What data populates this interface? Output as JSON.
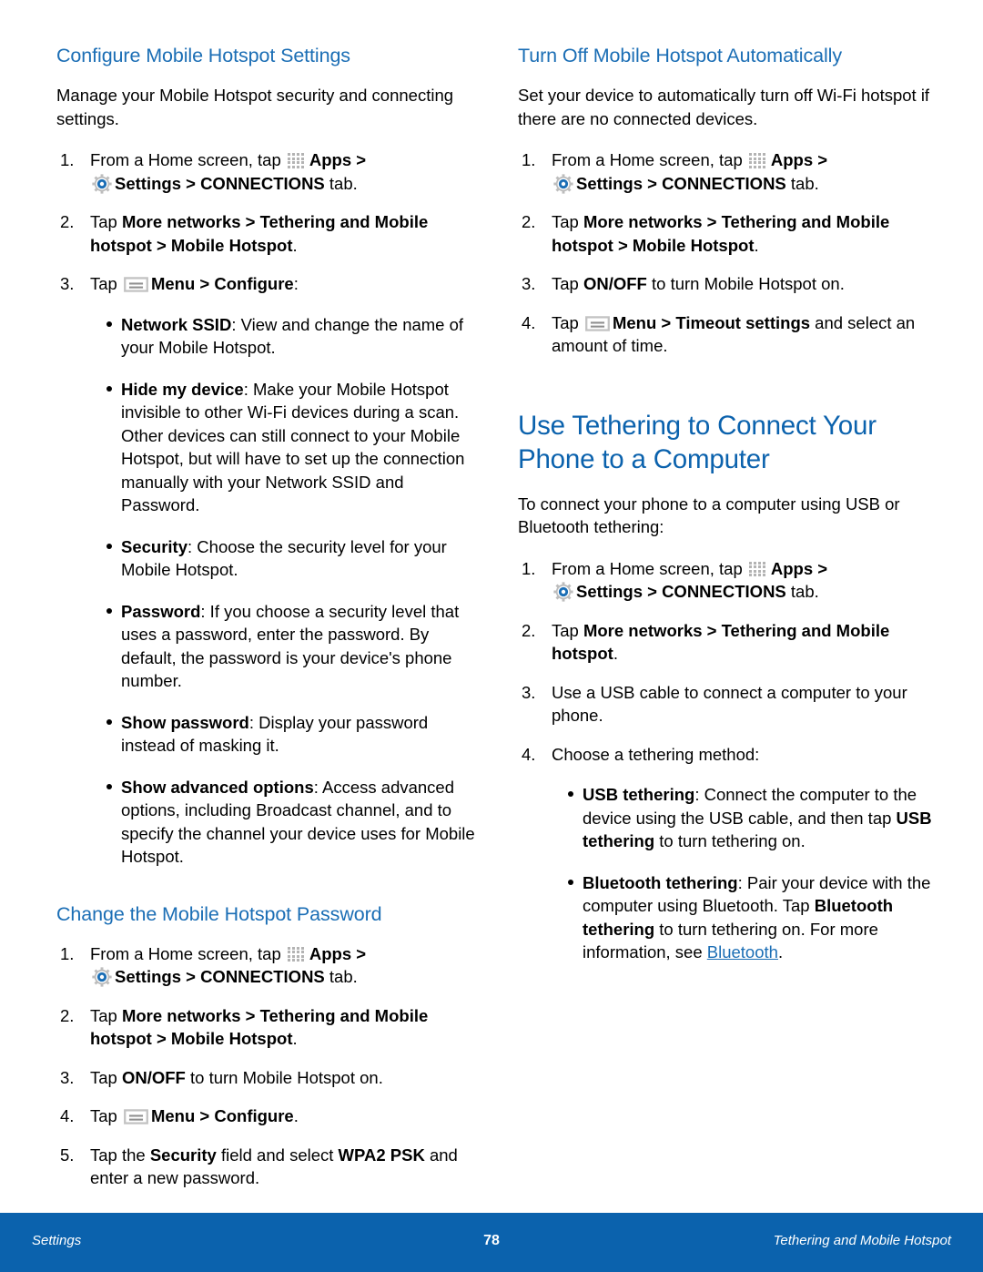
{
  "page": {
    "number": "78",
    "footer_left": "Settings",
    "footer_right": "Tethering and Mobile Hotspot",
    "footer_bg": "#0b62ad",
    "heading_color": "#1b6eb5",
    "title_color": "#0b62ad",
    "link_color": "#1b6eb5"
  },
  "icons": {
    "apps": "apps-grid-icon",
    "settings": "gear-icon",
    "menu": "menu-icon"
  },
  "left_column": {
    "section1": {
      "heading": "Configure Mobile Hotspot Settings",
      "intro": "Manage your Mobile Hotspot security and connecting settings.",
      "steps": [
        {
          "num": "1.",
          "parts": [
            {
              "t": "From a Home screen, tap ",
              "b": false
            },
            {
              "icon": "apps"
            },
            {
              "t": "Apps > ",
              "b": true
            },
            {
              "br": true
            },
            {
              "icon": "gear"
            },
            {
              "t": "Settings > CONNECTIONS",
              "b": true
            },
            {
              "t": " tab.",
              "b": false
            }
          ]
        },
        {
          "num": "2.",
          "parts": [
            {
              "t": "Tap ",
              "b": false
            },
            {
              "t": "More networks > Tethering and Mobile hotspot > Mobile Hotspot",
              "b": true
            },
            {
              "t": ".",
              "b": false
            }
          ]
        },
        {
          "num": "3.",
          "parts": [
            {
              "t": "Tap ",
              "b": false
            },
            {
              "icon": "menu"
            },
            {
              "t": "Menu > Configure",
              "b": true
            },
            {
              "t": ":",
              "b": false
            }
          ],
          "bullets": [
            {
              "label": "Network SSID",
              "text": ": View and change the name of your Mobile Hotspot."
            },
            {
              "label": "Hide my device",
              "text": ": Make your Mobile Hotspot invisible to other Wi-Fi devices during a scan. Other devices can still connect to your Mobile Hotspot, but will have to set up the connection manually with your Network SSID and Password."
            },
            {
              "label": "Security",
              "text": ": Choose the security level for your Mobile Hotspot."
            },
            {
              "label": "Password",
              "text": ": If you choose a security level that uses a password, enter the password. By default, the password is your device's phone number."
            },
            {
              "label": "Show password",
              "text": ": Display your password instead of masking it."
            },
            {
              "label": "Show advanced options",
              "text": ": Access advanced options, including Broadcast channel, and to specify the channel your device uses for Mobile Hotspot."
            }
          ]
        }
      ]
    },
    "section2": {
      "heading": "Change the Mobile Hotspot Password",
      "steps": [
        {
          "num": "1.",
          "parts": [
            {
              "t": "From a Home screen, tap ",
              "b": false
            },
            {
              "icon": "apps"
            },
            {
              "t": "Apps > ",
              "b": true
            },
            {
              "br": true
            },
            {
              "icon": "gear"
            },
            {
              "t": "Settings > CONNECTIONS",
              "b": true
            },
            {
              "t": " tab.",
              "b": false
            }
          ]
        },
        {
          "num": "2.",
          "parts": [
            {
              "t": "Tap ",
              "b": false
            },
            {
              "t": "More networks > Tethering and Mobile hotspot > Mobile Hotspot",
              "b": true
            },
            {
              "t": ".",
              "b": false
            }
          ]
        },
        {
          "num": "3.",
          "parts": [
            {
              "t": "Tap ",
              "b": false
            },
            {
              "t": "ON/OFF",
              "b": true
            },
            {
              "t": " to turn Mobile Hotspot on.",
              "b": false
            }
          ]
        },
        {
          "num": "4.",
          "parts": [
            {
              "t": "Tap ",
              "b": false
            },
            {
              "icon": "menu"
            },
            {
              "t": "Menu > Configure",
              "b": true
            },
            {
              "t": ".",
              "b": false
            }
          ]
        },
        {
          "num": "5.",
          "parts": [
            {
              "t": "Tap the ",
              "b": false
            },
            {
              "t": "Security",
              "b": true
            },
            {
              "t": " field and select ",
              "b": false
            },
            {
              "t": "WPA2 PSK",
              "b": true
            },
            {
              "t": " and enter a new password.",
              "b": false
            }
          ]
        }
      ]
    }
  },
  "right_column": {
    "section1": {
      "heading": "Turn Off Mobile Hotspot Automatically",
      "intro": "Set your device to automatically turn off Wi-Fi hotspot if there are no connected devices.",
      "steps": [
        {
          "num": "1.",
          "parts": [
            {
              "t": "From a Home screen, tap ",
              "b": false
            },
            {
              "icon": "apps"
            },
            {
              "t": "Apps > ",
              "b": true
            },
            {
              "br": true
            },
            {
              "icon": "gear"
            },
            {
              "t": "Settings > CONNECTIONS",
              "b": true
            },
            {
              "t": " tab.",
              "b": false
            }
          ]
        },
        {
          "num": "2.",
          "parts": [
            {
              "t": "Tap ",
              "b": false
            },
            {
              "t": "More networks > Tethering and Mobile hotspot > Mobile Hotspot",
              "b": true
            },
            {
              "t": ".",
              "b": false
            }
          ]
        },
        {
          "num": "3.",
          "parts": [
            {
              "t": "Tap ",
              "b": false
            },
            {
              "t": "ON/OFF",
              "b": true
            },
            {
              "t": " to turn Mobile Hotspot on.",
              "b": false
            }
          ]
        },
        {
          "num": "4.",
          "parts": [
            {
              "t": "Tap ",
              "b": false
            },
            {
              "icon": "menu"
            },
            {
              "t": "Menu > Timeout settings",
              "b": true
            },
            {
              "t": " and select an amount of time.",
              "b": false
            }
          ]
        }
      ]
    },
    "section2": {
      "title": "Use Tethering to Connect Your Phone to a Computer",
      "intro": "To connect your phone to a computer using USB or Bluetooth tethering:",
      "steps": [
        {
          "num": "1.",
          "parts": [
            {
              "t": "From a Home screen, tap ",
              "b": false
            },
            {
              "icon": "apps"
            },
            {
              "t": "Apps > ",
              "b": true
            },
            {
              "br": true
            },
            {
              "icon": "gear"
            },
            {
              "t": "Settings > CONNECTIONS",
              "b": true
            },
            {
              "t": " tab.",
              "b": false
            }
          ]
        },
        {
          "num": "2.",
          "parts": [
            {
              "t": "Tap ",
              "b": false
            },
            {
              "t": "More networks > Tethering and Mobile hotspot",
              "b": true
            },
            {
              "t": ".",
              "b": false
            }
          ]
        },
        {
          "num": "3.",
          "parts": [
            {
              "t": "Use a USB cable to connect a computer to your phone.",
              "b": false
            }
          ]
        },
        {
          "num": "4.",
          "parts": [
            {
              "t": "Choose a tethering method:",
              "b": false
            }
          ],
          "bullets": [
            {
              "label": "USB tethering",
              "segments": [
                {
                  "t": ": Connect the computer to the device using the USB cable, and then tap ",
                  "b": false
                },
                {
                  "t": "USB tethering",
                  "b": true
                },
                {
                  "t": " to turn tethering on.",
                  "b": false
                }
              ]
            },
            {
              "label": "Bluetooth tethering",
              "segments": [
                {
                  "t": ": Pair your device with the computer using Bluetooth. Tap ",
                  "b": false
                },
                {
                  "t": "Bluetooth tethering",
                  "b": true
                },
                {
                  "t": " to turn tethering on. For more information, see ",
                  "b": false
                },
                {
                  "t": "Bluetooth",
                  "link": true
                },
                {
                  "t": ".",
                  "b": false
                }
              ]
            }
          ]
        }
      ]
    }
  }
}
